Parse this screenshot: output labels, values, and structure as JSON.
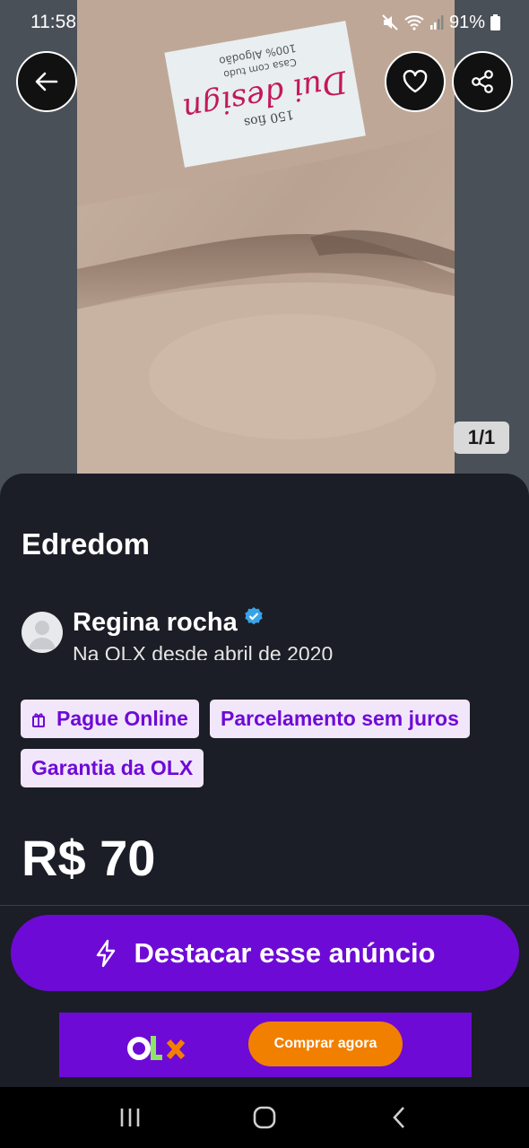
{
  "status": {
    "time": "11:58",
    "battery": "91%",
    "icons": [
      "mute-icon",
      "wifi-icon",
      "signal-icon",
      "battery-icon"
    ]
  },
  "gallery": {
    "counter": "1/1",
    "label_text": [
      "Dui design",
      "Casa com tudo",
      "100% Algodão",
      "150 fios"
    ]
  },
  "listing": {
    "title": "Edredom",
    "seller_name": "Regina rocha",
    "seller_since": "Na OLX desde abril de 2020",
    "tags": [
      "Pague Online",
      "Parcelamento sem juros",
      "Garantia da OLX"
    ],
    "price": "R$ 70"
  },
  "cta": {
    "label": "Destacar esse anúncio"
  },
  "ad": {
    "logo": "OLX",
    "button": "Comprar agora"
  },
  "colors": {
    "brand_purple": "#6e0ad6",
    "tag_bg": "#f2e6fb",
    "orange": "#f28000",
    "verified_blue": "#3aa3e8",
    "sheet_bg": "#1b1e26"
  }
}
